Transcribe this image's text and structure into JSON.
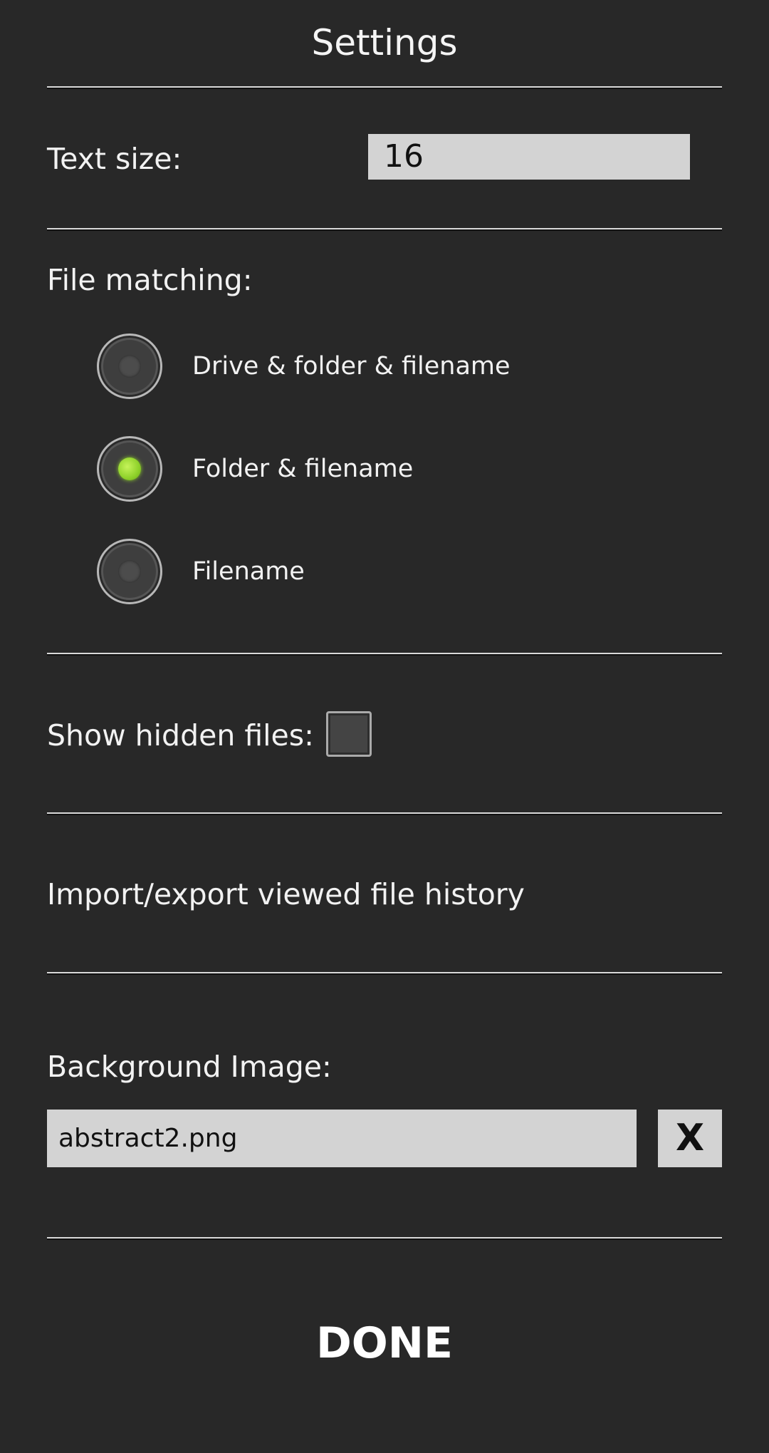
{
  "title": "Settings",
  "text_size": {
    "label": "Text size:",
    "value": "16"
  },
  "file_matching": {
    "label": "File matching:",
    "options": [
      {
        "label": "Drive & folder & filename",
        "selected": false
      },
      {
        "label": "Folder & filename",
        "selected": true
      },
      {
        "label": "Filename",
        "selected": false
      }
    ]
  },
  "show_hidden": {
    "label": "Show hidden files:",
    "checked": false
  },
  "history": {
    "label": "Import/export viewed file history"
  },
  "background": {
    "label": "Background Image:",
    "value": "abstract2.png",
    "clear_label": "X"
  },
  "done_label": "DONE",
  "colors": {
    "background": "#282828",
    "field": "#d3d3d3",
    "radio_selected": "#8ed12a",
    "text": "#f2f2f2"
  }
}
